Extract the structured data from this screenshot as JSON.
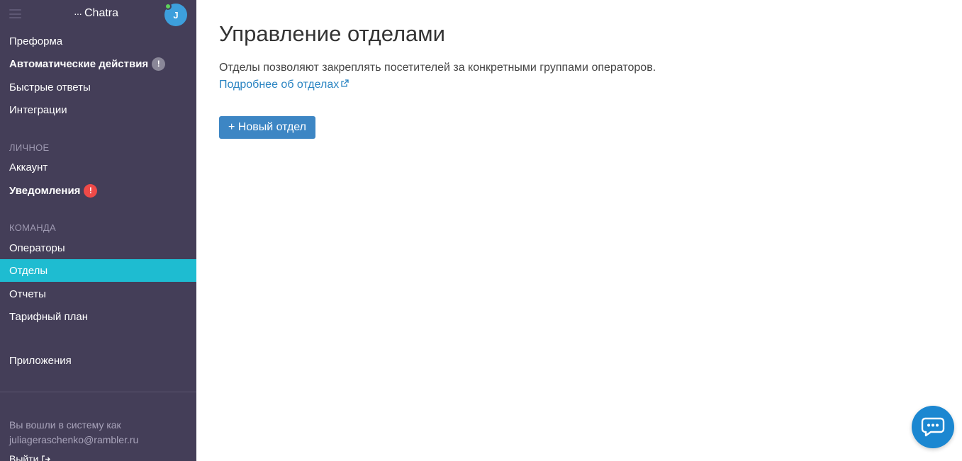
{
  "sidebar": {
    "brand": "Chatra",
    "avatar_initial": "J",
    "items_top": [
      {
        "label": "Преформа"
      },
      {
        "label": "Автоматические действия",
        "badge": "!"
      },
      {
        "label": "Быстрые ответы"
      },
      {
        "label": "Интеграции"
      }
    ],
    "section_personal": "ЛИЧНОЕ",
    "items_personal": [
      {
        "label": "Аккаунт"
      },
      {
        "label": "Уведомления",
        "badge": "!"
      }
    ],
    "section_team": "КОМАНДА",
    "items_team": [
      {
        "label": "Операторы"
      },
      {
        "label": "Отделы"
      },
      {
        "label": "Отчеты"
      },
      {
        "label": "Тарифный план"
      }
    ],
    "apps": "Приложения",
    "logged_in_label": "Вы вошли в систему как",
    "user_email": "juliageraschenko@rambler.ru",
    "logout": "Выйти"
  },
  "main": {
    "title": "Управление отделами",
    "description": "Отделы позволяют закреплять посетителей за конкретными группами операторов.",
    "more_link": "Подробнее об отделах",
    "new_button": "+ Новый отдел"
  },
  "colors": {
    "sidebar_bg": "#443e58",
    "active_item": "#1ebcd1",
    "primary_button": "#3d86c4",
    "link": "#2a84c2",
    "chat_fab": "#1b87d1"
  }
}
